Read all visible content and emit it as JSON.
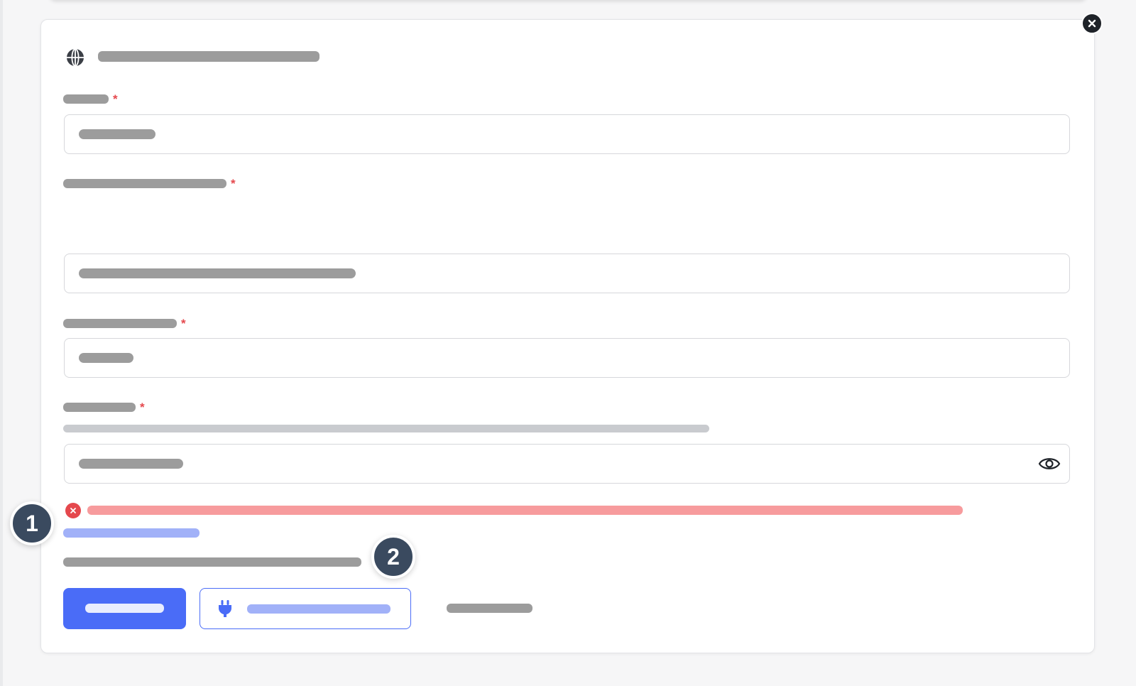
{
  "dialog": {
    "close_icon": "close-icon",
    "header_icon": "globe-icon",
    "title": "",
    "required_marker": "*"
  },
  "fields": [
    {
      "label": "",
      "required": true,
      "value": ""
    },
    {
      "label": "",
      "required": true,
      "description": "",
      "value": ""
    },
    {
      "label": "",
      "required": true,
      "value": ""
    },
    {
      "label": "",
      "required": true,
      "description": "",
      "value": "",
      "trailing_icon": "eye-icon"
    }
  ],
  "error": {
    "icon": "error-circle-icon",
    "message": "",
    "link": ""
  },
  "footer": {
    "note": "",
    "primary_button": "",
    "secondary_button": "",
    "secondary_icon": "plug-icon",
    "text_link": ""
  },
  "badges": [
    "1",
    "2"
  ],
  "colors": {
    "primary": "#4a6cf7",
    "error": "#e5484d",
    "badge": "#3a4a5f"
  }
}
